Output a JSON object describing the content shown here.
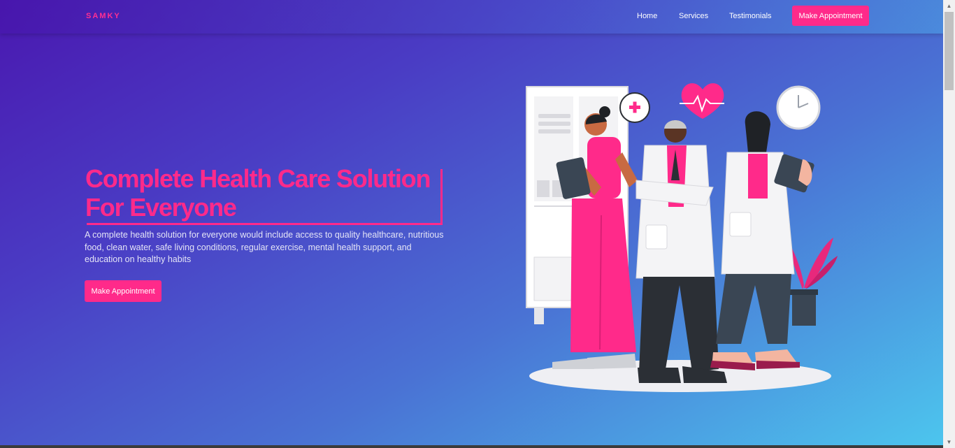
{
  "nav": {
    "brand": "SAMKY",
    "links": [
      "Home",
      "Services",
      "Testimonials"
    ],
    "cta": "Make Appointment"
  },
  "hero": {
    "title_line1": "Complete Health Care Solution",
    "title_line2": "For Everyone",
    "description": "A complete health solution for everyone would include access to quality healthcare, nutritious food, clean water, safe living conditions, regular exercise, mental health support, and education on healthy habits",
    "cta": "Make Appointment",
    "illustration_icons": [
      "plus-icon",
      "heart-pulse-icon",
      "clock-icon"
    ]
  },
  "colors": {
    "accent": "#ff2a8a",
    "gradient_start": "#4a18b0",
    "gradient_end": "#4cc6ee"
  }
}
